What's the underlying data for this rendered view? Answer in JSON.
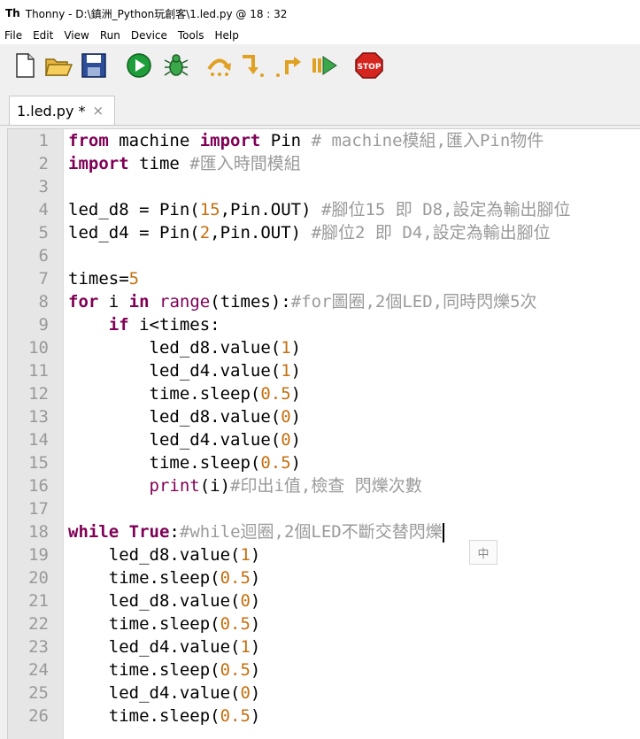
{
  "window": {
    "title": "Thonny  -  D:\\鎮洲_Python玩創客\\1.led.py  @  18 : 32"
  },
  "menu": [
    "File",
    "Edit",
    "View",
    "Run",
    "Device",
    "Tools",
    "Help"
  ],
  "toolbar": {
    "buttons": [
      {
        "name": "new-file-button",
        "icon": "new-file-icon"
      },
      {
        "name": "open-file-button",
        "icon": "open-folder-icon"
      },
      {
        "name": "save-file-button",
        "icon": "save-icon"
      },
      {
        "name": "run-button",
        "icon": "run-icon"
      },
      {
        "name": "debug-button",
        "icon": "bug-icon"
      },
      {
        "name": "step-over-button",
        "icon": "step-over-icon"
      },
      {
        "name": "step-into-button",
        "icon": "step-into-icon"
      },
      {
        "name": "step-out-button",
        "icon": "step-out-icon"
      },
      {
        "name": "resume-button",
        "icon": "resume-icon"
      },
      {
        "name": "stop-button",
        "icon": "stop-icon",
        "label": "STOP"
      }
    ],
    "colors": {
      "run": "#1e9e3a",
      "stop": "#d6241f",
      "step": "#e0a022"
    }
  },
  "tab": {
    "title": "1.led.py *",
    "close": "×"
  },
  "editor": {
    "cursor_line": 18,
    "lines": [
      {
        "n": "1",
        "segs": [
          {
            "t": "from",
            "c": "k"
          },
          {
            "t": " machine ",
            "c": ""
          },
          {
            "t": "import",
            "c": "k"
          },
          {
            "t": " Pin ",
            "c": ""
          },
          {
            "t": "# machine模組,匯入Pin物件",
            "c": "c"
          }
        ]
      },
      {
        "n": "2",
        "segs": [
          {
            "t": "import",
            "c": "k"
          },
          {
            "t": " time ",
            "c": ""
          },
          {
            "t": "#匯入時間模組",
            "c": "c"
          }
        ]
      },
      {
        "n": "3",
        "segs": []
      },
      {
        "n": "4",
        "segs": [
          {
            "t": "led_d8 = Pin(",
            "c": ""
          },
          {
            "t": "15",
            "c": "n"
          },
          {
            "t": ",Pin.OUT) ",
            "c": ""
          },
          {
            "t": "#腳位15 即 D8,設定為輸出腳位",
            "c": "c"
          }
        ]
      },
      {
        "n": "5",
        "segs": [
          {
            "t": "led_d4 = Pin(",
            "c": ""
          },
          {
            "t": "2",
            "c": "n"
          },
          {
            "t": ",Pin.OUT) ",
            "c": ""
          },
          {
            "t": "#腳位2 即 D4,設定為輸出腳位",
            "c": "c"
          }
        ]
      },
      {
        "n": "6",
        "segs": []
      },
      {
        "n": "7",
        "segs": [
          {
            "t": "times=",
            "c": ""
          },
          {
            "t": "5",
            "c": "n"
          }
        ]
      },
      {
        "n": "8",
        "segs": [
          {
            "t": "for",
            "c": "k"
          },
          {
            "t": " i ",
            "c": ""
          },
          {
            "t": "in",
            "c": "k"
          },
          {
            "t": " ",
            "c": ""
          },
          {
            "t": "range",
            "c": "bi"
          },
          {
            "t": "(times):",
            "c": ""
          },
          {
            "t": "#for圖圈,2個LED,同時閃爍5次",
            "c": "c"
          }
        ]
      },
      {
        "n": "9",
        "segs": [
          {
            "t": "    ",
            "c": ""
          },
          {
            "t": "if",
            "c": "k"
          },
          {
            "t": " i<times:",
            "c": ""
          }
        ]
      },
      {
        "n": "10",
        "segs": [
          {
            "t": "        led_d8.value(",
            "c": ""
          },
          {
            "t": "1",
            "c": "n"
          },
          {
            "t": ")",
            "c": ""
          }
        ]
      },
      {
        "n": "11",
        "segs": [
          {
            "t": "        led_d4.value(",
            "c": ""
          },
          {
            "t": "1",
            "c": "n"
          },
          {
            "t": ")",
            "c": ""
          }
        ]
      },
      {
        "n": "12",
        "segs": [
          {
            "t": "        time.sleep(",
            "c": ""
          },
          {
            "t": "0.5",
            "c": "n"
          },
          {
            "t": ")",
            "c": ""
          }
        ]
      },
      {
        "n": "13",
        "segs": [
          {
            "t": "        led_d8.value(",
            "c": ""
          },
          {
            "t": "0",
            "c": "n"
          },
          {
            "t": ")",
            "c": ""
          }
        ]
      },
      {
        "n": "14",
        "segs": [
          {
            "t": "        led_d4.value(",
            "c": ""
          },
          {
            "t": "0",
            "c": "n"
          },
          {
            "t": ")",
            "c": ""
          }
        ]
      },
      {
        "n": "15",
        "segs": [
          {
            "t": "        time.sleep(",
            "c": ""
          },
          {
            "t": "0.5",
            "c": "n"
          },
          {
            "t": ")",
            "c": ""
          }
        ]
      },
      {
        "n": "16",
        "segs": [
          {
            "t": "        ",
            "c": ""
          },
          {
            "t": "print",
            "c": "bi"
          },
          {
            "t": "(i)",
            "c": ""
          },
          {
            "t": "#印出i值,檢查 閃爍次數",
            "c": "c"
          }
        ]
      },
      {
        "n": "17",
        "segs": []
      },
      {
        "n": "18",
        "segs": [
          {
            "t": "while",
            "c": "k"
          },
          {
            "t": " ",
            "c": ""
          },
          {
            "t": "True",
            "c": "k"
          },
          {
            "t": ":",
            "c": ""
          },
          {
            "t": "#while迴圈,2個LED不斷交替閃爍",
            "c": "c"
          }
        ]
      },
      {
        "n": "19",
        "segs": [
          {
            "t": "    led_d8.value(",
            "c": ""
          },
          {
            "t": "1",
            "c": "n"
          },
          {
            "t": ")",
            "c": ""
          }
        ]
      },
      {
        "n": "20",
        "segs": [
          {
            "t": "    time.sleep(",
            "c": ""
          },
          {
            "t": "0.5",
            "c": "n"
          },
          {
            "t": ")",
            "c": ""
          }
        ]
      },
      {
        "n": "21",
        "segs": [
          {
            "t": "    led_d8.value(",
            "c": ""
          },
          {
            "t": "0",
            "c": "n"
          },
          {
            "t": ")",
            "c": ""
          }
        ]
      },
      {
        "n": "22",
        "segs": [
          {
            "t": "    time.sleep(",
            "c": ""
          },
          {
            "t": "0.5",
            "c": "n"
          },
          {
            "t": ")",
            "c": ""
          }
        ]
      },
      {
        "n": "23",
        "segs": [
          {
            "t": "    led_d4.value(",
            "c": ""
          },
          {
            "t": "1",
            "c": "n"
          },
          {
            "t": ")",
            "c": ""
          }
        ]
      },
      {
        "n": "24",
        "segs": [
          {
            "t": "    time.sleep(",
            "c": ""
          },
          {
            "t": "0.5",
            "c": "n"
          },
          {
            "t": ")",
            "c": ""
          }
        ]
      },
      {
        "n": "25",
        "segs": [
          {
            "t": "    led_d4.value(",
            "c": ""
          },
          {
            "t": "0",
            "c": "n"
          },
          {
            "t": ")",
            "c": ""
          }
        ]
      },
      {
        "n": "26",
        "segs": [
          {
            "t": "    time.sleep(",
            "c": ""
          },
          {
            "t": "0.5",
            "c": "n"
          },
          {
            "t": ")",
            "c": ""
          }
        ]
      }
    ]
  },
  "ime": {
    "label": "中"
  }
}
